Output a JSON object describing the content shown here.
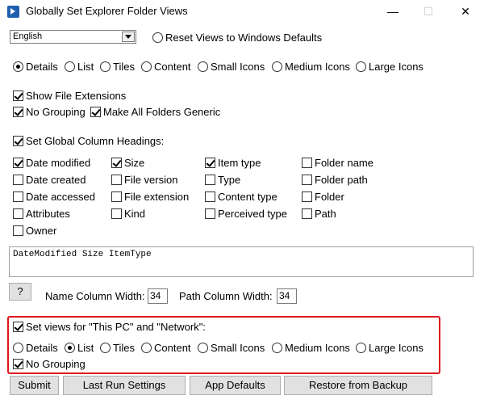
{
  "window": {
    "title": "Globally Set Explorer Folder Views",
    "minimize": "—",
    "maximize": "☐",
    "close": "✕"
  },
  "language": {
    "selected": "English"
  },
  "reset": {
    "label": "Reset Views to Windows Defaults",
    "checked": false
  },
  "view_modes": {
    "options": [
      "Details",
      "List",
      "Tiles",
      "Content",
      "Small Icons",
      "Medium Icons",
      "Large Icons"
    ],
    "selected": "Details"
  },
  "options": {
    "show_file_extensions": {
      "label": "Show File Extensions",
      "checked": true
    },
    "no_grouping": {
      "label": "No Grouping",
      "checked": true
    },
    "make_generic": {
      "label": "Make All Folders Generic",
      "checked": true
    }
  },
  "column_headings": {
    "label": "Set Global Column Headings:",
    "checked": true,
    "items": [
      {
        "label": "Date modified",
        "checked": true
      },
      {
        "label": "Date created",
        "checked": false
      },
      {
        "label": "Date accessed",
        "checked": false
      },
      {
        "label": "Attributes",
        "checked": false
      },
      {
        "label": "Owner",
        "checked": false
      },
      {
        "label": "Size",
        "checked": true
      },
      {
        "label": "File version",
        "checked": false
      },
      {
        "label": "File extension",
        "checked": false
      },
      {
        "label": "Kind",
        "checked": false
      },
      {
        "label": "Item type",
        "checked": true
      },
      {
        "label": "Type",
        "checked": false
      },
      {
        "label": "Content type",
        "checked": false
      },
      {
        "label": "Perceived type",
        "checked": false
      },
      {
        "label": "Folder name",
        "checked": false
      },
      {
        "label": "Folder path",
        "checked": false
      },
      {
        "label": "Folder",
        "checked": false
      },
      {
        "label": "Path",
        "checked": false
      }
    ],
    "value": "DateModified Size ItemType"
  },
  "widths": {
    "help_label": "?",
    "name_label": "Name Column Width:",
    "name_value": "34",
    "path_label": "Path Column Width:",
    "path_value": "34"
  },
  "this_pc": {
    "label": "Set views for \"This PC\" and \"Network\":",
    "checked": true,
    "view_options": [
      "Details",
      "List",
      "Tiles",
      "Content",
      "Small Icons",
      "Medium Icons",
      "Large Icons"
    ],
    "selected": "List",
    "no_grouping": {
      "label": "No Grouping",
      "checked": true
    },
    "highlight_color": "#e0161c"
  },
  "buttons": {
    "submit": "Submit",
    "last_run": "Last Run Settings",
    "app_defaults": "App Defaults",
    "restore": "Restore from Backup"
  }
}
